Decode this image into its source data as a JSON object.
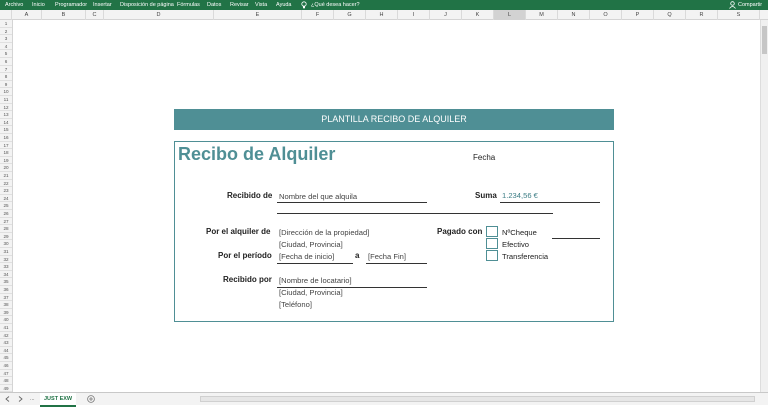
{
  "ribbon": {
    "tabs": [
      "Archivo",
      "Inicio",
      "Programador",
      "Insertar",
      "Disposición de página",
      "Fórmulas",
      "Datos",
      "Revisar",
      "Vista",
      "Ayuda"
    ],
    "tell_me": "¿Qué desea hacer?",
    "share": "Compartir"
  },
  "columns": [
    "A",
    "B",
    "C",
    "D",
    "E",
    "F",
    "G",
    "H",
    "I",
    "J",
    "K",
    "L",
    "M",
    "N",
    "O",
    "P",
    "Q",
    "R",
    "S"
  ],
  "rows": [
    "1",
    "2",
    "3",
    "4",
    "5",
    "6",
    "7",
    "8",
    "9",
    "10",
    "11",
    "12",
    "13",
    "14",
    "15",
    "16",
    "17",
    "18",
    "19",
    "20",
    "21",
    "22",
    "23",
    "24",
    "25",
    "26",
    "27",
    "28",
    "29",
    "30",
    "31",
    "32",
    "33",
    "34",
    "35",
    "36",
    "37",
    "38",
    "39",
    "40",
    "41",
    "42",
    "43",
    "44",
    "45",
    "46",
    "47",
    "48",
    "49"
  ],
  "sheet": {
    "tab": "JUST EXW",
    "ellipsis": "..."
  },
  "banner": "PLANTILLA RECIBO DE ALQUILER",
  "form": {
    "title": "Recibo de Alquiler",
    "fecha_label": "Fecha",
    "recibido_de_label": "Recibido de",
    "recibido_de_value": "Nombre del que alquila",
    "suma_label": "Suma",
    "suma_value": "1.234,56 €",
    "alquiler_label": "Por el alquiler de",
    "alquiler_value": "[Dirección de la propiedad]",
    "alquiler_ciudad": "[Ciudad, Provincia]",
    "periodo_label": "Por el período",
    "periodo_inicio": "[Fecha de inicio]",
    "periodo_a": "a",
    "periodo_fin": "[Fecha Fin]",
    "recibido_por_label": "Recibido por",
    "recibido_por_value": "[Nombre de locatario]",
    "recibido_por_ciudad": "[Ciudad, Provincia]",
    "recibido_por_tel": "[Teléfono]",
    "pagado_label": "Pagado con",
    "pagos": [
      "NºCheque",
      "Efectivo",
      "Transferencia"
    ]
  },
  "colors": {
    "excel_green": "#217346",
    "teal": "#4f8f95"
  }
}
